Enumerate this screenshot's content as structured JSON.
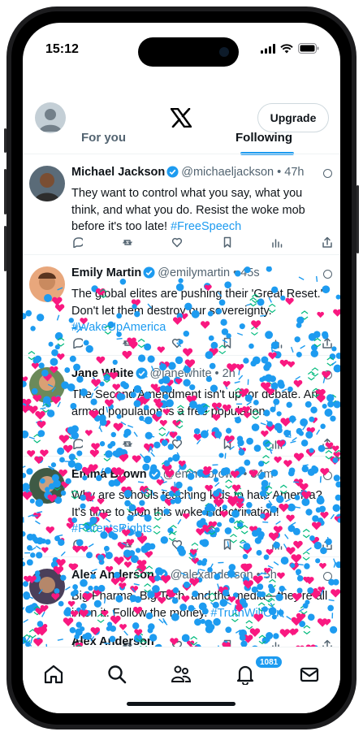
{
  "status_bar": {
    "time": "15:12"
  },
  "header": {
    "upgrade_label": "Upgrade"
  },
  "tabs": [
    {
      "label": "For you",
      "active": false
    },
    {
      "label": "Following",
      "active": true
    }
  ],
  "posts": [
    {
      "name": "Michael Jackson",
      "handle": "@michaeljackson",
      "time": "47h",
      "text": "They want to control what you say, what you think, and what you do. Resist the woke mob before it's too late!",
      "hashtag": "#FreeSpeech"
    },
    {
      "name": "Emily Martin",
      "handle": "@emilymartin",
      "time": "45s",
      "text": "The global elites are pushing their 'Great Reset.' Don't let them destroy our sovereignty.",
      "hashtag": "#WakeUpAmerica"
    },
    {
      "name": "Jane White",
      "handle": "@janewhite",
      "time": "2h",
      "text": "The Second Amendment isn't up for debate. An armed population is a free population.",
      "hashtag": ""
    },
    {
      "name": "Emma Brown",
      "handle": "@emmabrown",
      "time": "34m",
      "text": "Why are schools teaching kids to hate America? It's time to stop this woke indoctrination!",
      "hashtag": "#ParentsRights"
    },
    {
      "name": "Alex Anderson",
      "handle": "@alexanderson",
      "time": "5h",
      "text": "Big Pharma, Big Tech, and the media—they're all in on it. Follow the money.",
      "hashtag": "#TruthWillOut"
    }
  ],
  "peek_name": "Alex Anderson",
  "bottom_nav": {
    "items": [
      "home-icon",
      "search-icon",
      "communities-icon",
      "notifications-icon",
      "messages-icon"
    ],
    "notification_count": "1081"
  },
  "colors": {
    "accent": "#1d9bf0",
    "heart": "#f91880",
    "text": "#0f1419",
    "muted": "#536471"
  }
}
